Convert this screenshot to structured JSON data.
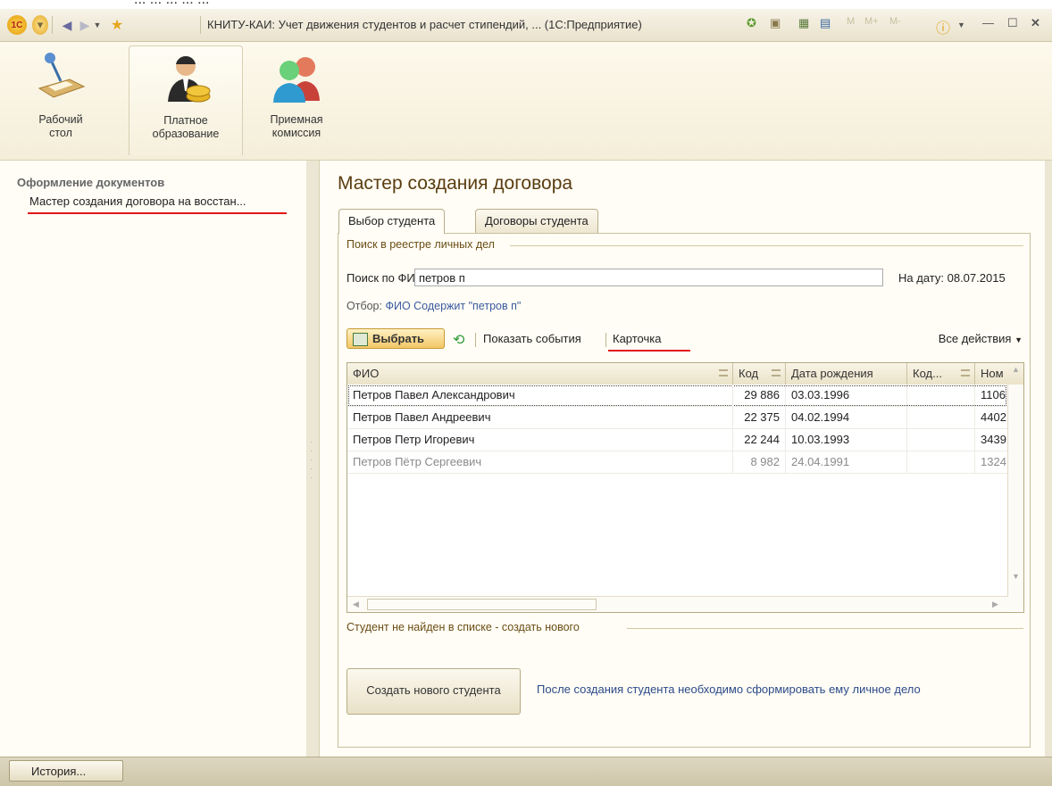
{
  "window": {
    "title": "КНИТУ-КАИ: Учет движения студентов и расчет стипендий, ...  (1С:Предприятие)",
    "top_caption": "... ... ... ... ..."
  },
  "sections": [
    {
      "label_line1": "Рабочий",
      "label_line2": "стол"
    },
    {
      "label_line1": "Платное",
      "label_line2": "образование"
    },
    {
      "label_line1": "Приемная",
      "label_line2": "комиссия"
    }
  ],
  "left_panel": {
    "heading": "Оформление документов",
    "link": "Мастер создания договора на восстан..."
  },
  "form": {
    "title": "Мастер создания договора",
    "tabs": [
      "Выбор студента",
      "Договоры студента"
    ],
    "search_group_title": "Поиск в реестре личных дел",
    "search_label": "Поиск по ФИО:",
    "search_value": "петров п",
    "date_label": "На дату:",
    "date_value": "08.07.2015",
    "filter_label": "Отбор:",
    "filter_value": "ФИО Содержит \"петров п\"",
    "select_button": "Выбрать",
    "show_events": "Показать события",
    "card": "Карточка",
    "all_actions": "Все действия",
    "columns": [
      "ФИО",
      "Код",
      "Дата рождения",
      "Код...",
      "Ном"
    ],
    "rows": [
      {
        "fio": "Петров Павел Александрович",
        "code": "29 886",
        "birth": "03.03.1996",
        "code2": "",
        "num": "1106"
      },
      {
        "fio": "Петров Павел Андреевич",
        "code": "22 375",
        "birth": "04.02.1994",
        "code2": "",
        "num": "4402"
      },
      {
        "fio": "Петров Петр Игоревич",
        "code": "22 244",
        "birth": "10.03.1993",
        "code2": "",
        "num": "3439"
      },
      {
        "fio": "Петров Пётр Сергеевич",
        "code": "8 982",
        "birth": "24.04.1991",
        "code2": "",
        "num": "1324"
      }
    ],
    "not_found_group_title": "Студент не найден в списке - создать нового",
    "create_button": "Создать нового студента",
    "hint": "После создания студента необходимо сформировать ему личное дело"
  },
  "bottom": {
    "history_button": "История..."
  },
  "colors": {
    "title_accent": "#5a3c10",
    "underline": "#e01818",
    "link_blue": "#3b5aa0"
  }
}
